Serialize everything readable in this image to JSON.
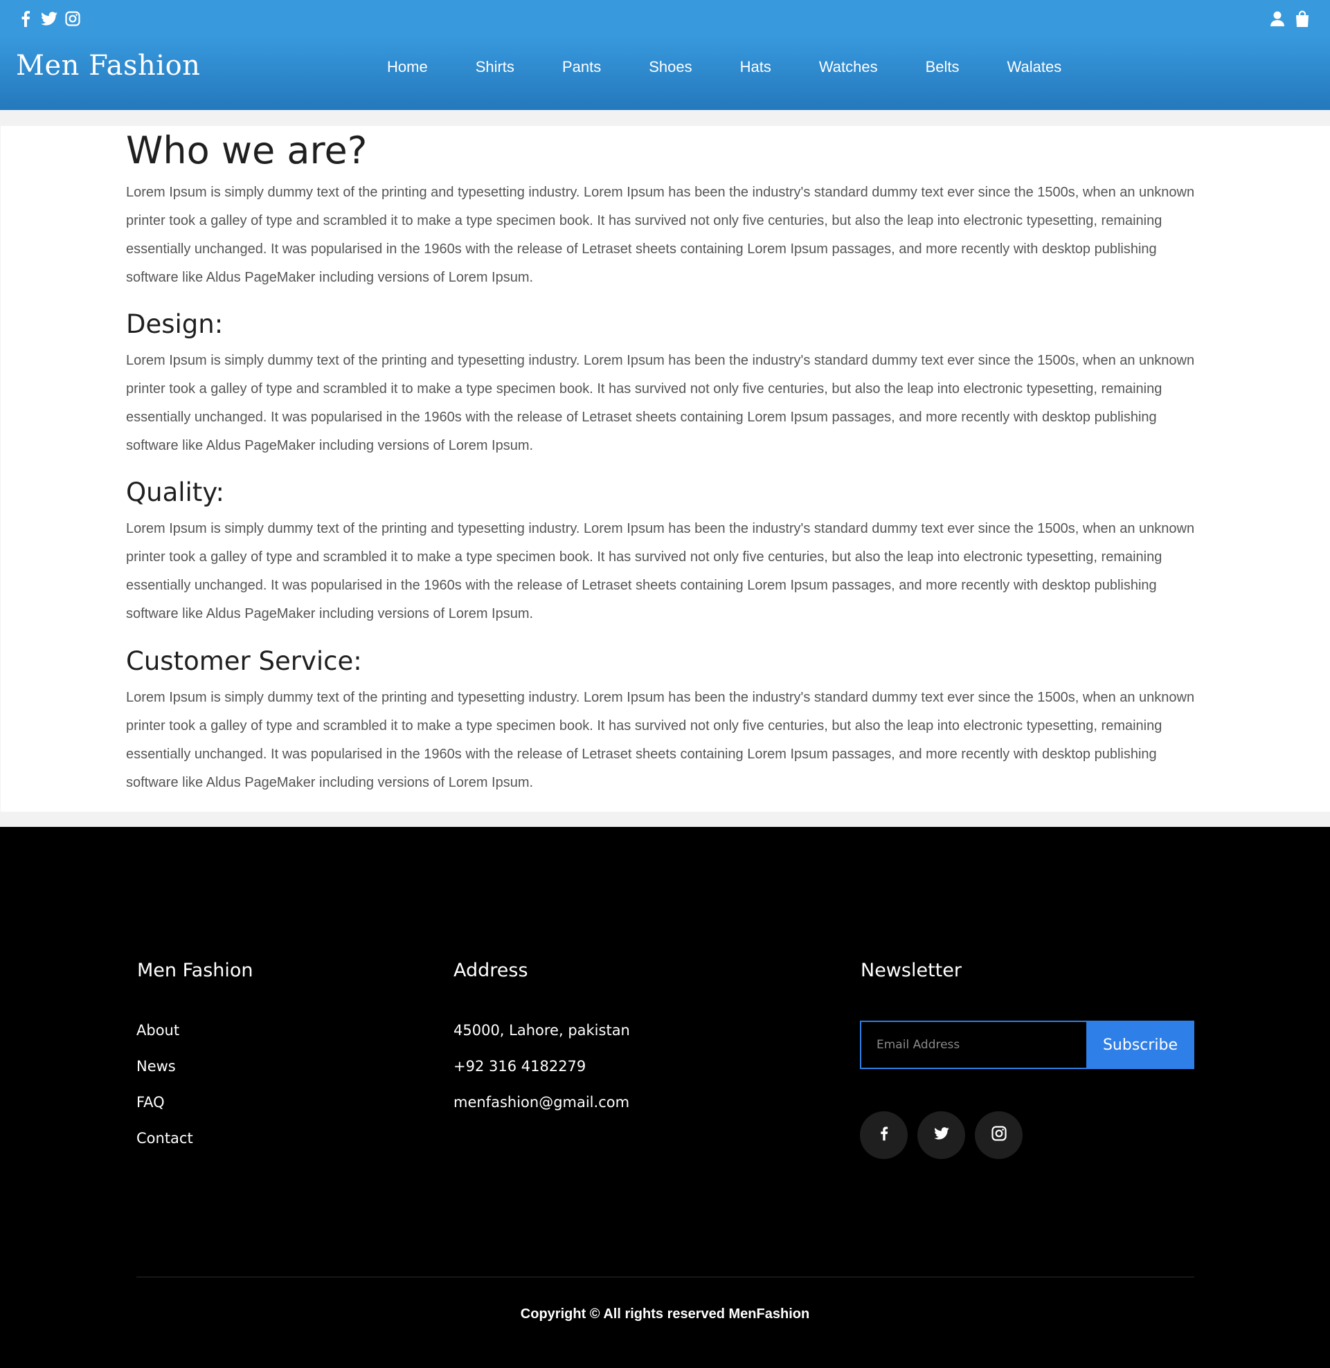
{
  "header": {
    "logo": "Men Fashion",
    "social_icons": [
      "facebook-icon",
      "twitter-icon",
      "instagram-icon"
    ],
    "account_icons": [
      "user-icon",
      "shopping-bag-icon"
    ],
    "nav": [
      {
        "label": "Home"
      },
      {
        "label": "Shirts"
      },
      {
        "label": "Pants"
      },
      {
        "label": "Shoes"
      },
      {
        "label": "Hats"
      },
      {
        "label": "Watches"
      },
      {
        "label": "Belts"
      },
      {
        "label": "Walates"
      }
    ],
    "colors": {
      "gradient_top": "#3899dd",
      "gradient_bottom": "#2578bc"
    }
  },
  "main": {
    "sections": [
      {
        "title": "Who we are?",
        "text": "Lorem Ipsum is simply dummy text of the printing and typesetting industry. Lorem Ipsum has been the industry's standard dummy text ever since the 1500s, when an unknown printer took a galley of type and scrambled it to make a type specimen book. It has survived not only five centuries, but also the leap into electronic typesetting, remaining essentially unchanged. It was popularised in the 1960s with the release of Letraset sheets containing Lorem Ipsum passages, and more recently with desktop publishing software like Aldus PageMaker including versions of Lorem Ipsum."
      },
      {
        "title": "Design:",
        "text": "Lorem Ipsum is simply dummy text of the printing and typesetting industry. Lorem Ipsum has been the industry's standard dummy text ever since the 1500s, when an unknown printer took a galley of type and scrambled it to make a type specimen book. It has survived not only five centuries, but also the leap into electronic typesetting, remaining essentially unchanged. It was popularised in the 1960s with the release of Letraset sheets containing Lorem Ipsum passages, and more recently with desktop publishing software like Aldus PageMaker including versions of Lorem Ipsum."
      },
      {
        "title": "Quality:",
        "text": "Lorem Ipsum is simply dummy text of the printing and typesetting industry. Lorem Ipsum has been the industry's standard dummy text ever since the 1500s, when an unknown printer took a galley of type and scrambled it to make a type specimen book. It has survived not only five centuries, but also the leap into electronic typesetting, remaining essentially unchanged. It was popularised in the 1960s with the release of Letraset sheets containing Lorem Ipsum passages, and more recently with desktop publishing software like Aldus PageMaker including versions of Lorem Ipsum."
      },
      {
        "title": "Customer Service:",
        "text": "Lorem Ipsum is simply dummy text of the printing and typesetting industry. Lorem Ipsum has been the industry's standard dummy text ever since the 1500s, when an unknown printer took a galley of type and scrambled it to make a type specimen book. It has survived not only five centuries, but also the leap into electronic typesetting, remaining essentially unchanged. It was popularised in the 1960s with the release of Letraset sheets containing Lorem Ipsum passages, and more recently with desktop publishing software like Aldus PageMaker including versions of Lorem Ipsum."
      }
    ]
  },
  "footer": {
    "brand": {
      "title": "Men Fashion",
      "links": [
        "About",
        "News",
        "FAQ",
        "Contact"
      ]
    },
    "address": {
      "title": "Address",
      "lines": [
        "45000, Lahore, pakistan",
        "+92 316 4182279",
        "menfashion@gmail.com"
      ]
    },
    "newsletter": {
      "title": "Newsletter",
      "email_value": "",
      "email_placeholder": "Email Address",
      "subscribe_label": "Subscribe",
      "accent": "#2f7fe8",
      "social_icons": [
        "facebook-icon",
        "twitter-icon",
        "instagram-icon"
      ]
    },
    "copyright": "Copyright © All rights reserved MenFashion"
  }
}
